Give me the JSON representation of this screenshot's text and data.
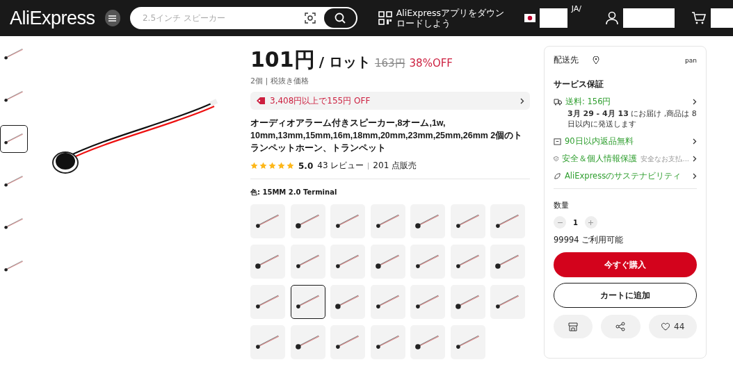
{
  "header": {
    "logo": "AliExpress",
    "search": {
      "placeholder": "2.5インチ スピーカー"
    },
    "app_promo": "AliExpressアプリをダウンロードしよう",
    "language": "JA/"
  },
  "gallery": {
    "thumbnails": [
      {
        "selected": false
      },
      {
        "selected": false
      },
      {
        "selected": true
      },
      {
        "selected": false
      },
      {
        "selected": false
      },
      {
        "selected": false
      }
    ]
  },
  "product": {
    "price": "101円",
    "unit": "/ ロット",
    "original_price": "163円",
    "discount": "38%OFF",
    "price_note": "2個 | 税抜き価格",
    "coupon": "3,408円以上で155円 OFF",
    "title": "オーディオアラーム付きスピーカー,8オーム,1w, 10mm,13mm,15mm,16m,18mm,20mm,23mm,25mm,26mm 2個のトランペットホーン、トランペット",
    "stars": 5,
    "rating": "5.0",
    "reviews": "43 レビュー",
    "sold": "201 点販売",
    "color_label": "色: 15MM 2.0 Terminal",
    "variants": [
      {
        "selected": false
      },
      {
        "selected": false
      },
      {
        "selected": false
      },
      {
        "selected": false
      },
      {
        "selected": false
      },
      {
        "selected": false
      },
      {
        "selected": false
      },
      {
        "selected": false
      },
      {
        "selected": false
      },
      {
        "selected": false
      },
      {
        "selected": false
      },
      {
        "selected": false
      },
      {
        "selected": false
      },
      {
        "selected": false
      },
      {
        "selected": false
      },
      {
        "selected": true
      },
      {
        "selected": false
      },
      {
        "selected": false
      },
      {
        "selected": false
      },
      {
        "selected": false
      },
      {
        "selected": false
      },
      {
        "selected": false
      },
      {
        "selected": false
      },
      {
        "selected": false
      },
      {
        "selected": false
      },
      {
        "selected": false
      },
      {
        "selected": false
      }
    ]
  },
  "side": {
    "ship_to": "配送先",
    "ship_country": "pan",
    "service_title": "サービス保証",
    "shipping": "送料: 156円",
    "delivery": "**3月 29 - 4月 13** にお届け ,商品は 8 日以内に発送します",
    "guarantees": [
      {
        "kind": "returns",
        "label": "90日以内返品無料"
      },
      {
        "kind": "security",
        "label": "安全＆個人情報保護",
        "note": "安全なお支払..."
      },
      {
        "kind": "sustainability",
        "label": "AliExpressのサステナビリティ"
      }
    ],
    "quantity_label": "数量",
    "quantity": "1",
    "available": "99994 ご利用可能",
    "buy_now": "今すぐ購入",
    "add_to_cart": "カートに追加",
    "wishlist_count": "44"
  }
}
